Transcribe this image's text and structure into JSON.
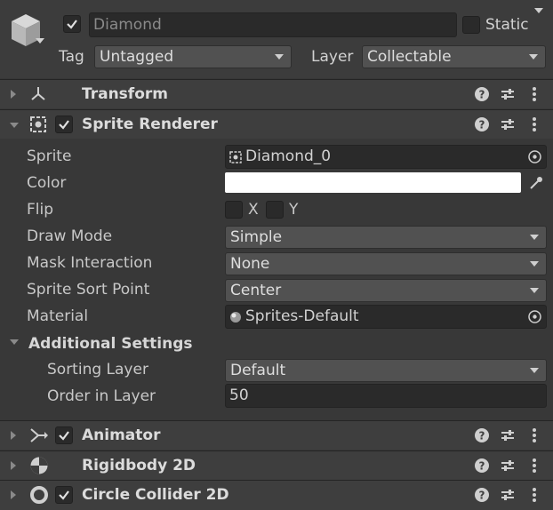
{
  "gameobject": {
    "name": "Diamond",
    "static_label": "Static",
    "tag_label": "Tag",
    "tag_value": "Untagged",
    "layer_label": "Layer",
    "layer_value": "Collectable",
    "icon": "cube-icon"
  },
  "components": {
    "transform": {
      "title": "Transform",
      "icon": "transform-icon"
    },
    "sprite_renderer": {
      "title": "Sprite Renderer",
      "icon": "sprite-renderer-icon",
      "properties": {
        "sprite_label": "Sprite",
        "sprite_value": "Diamond_0",
        "color_label": "Color",
        "color_value": "#ffffff",
        "flip_label": "Flip",
        "flip_x": "X",
        "flip_y": "Y",
        "draw_mode_label": "Draw Mode",
        "draw_mode_value": "Simple",
        "mask_label": "Mask Interaction",
        "mask_value": "None",
        "sort_point_label": "Sprite Sort Point",
        "sort_point_value": "Center",
        "material_label": "Material",
        "material_value": "Sprites-Default"
      },
      "additional": {
        "title": "Additional Settings",
        "sorting_layer_label": "Sorting Layer",
        "sorting_layer_value": "Default",
        "order_label": "Order in Layer",
        "order_value": "50"
      }
    },
    "animator": {
      "title": "Animator",
      "icon": "animator-icon"
    },
    "rigidbody": {
      "title": "Rigidbody 2D",
      "icon": "rigidbody-icon"
    },
    "collider": {
      "title": "Circle Collider 2D",
      "icon": "circle-collider-icon"
    }
  },
  "colors": {
    "background": "#383838",
    "header": "#3e3e3e",
    "field": "#2a2a2a",
    "dropdown": "#515151"
  }
}
